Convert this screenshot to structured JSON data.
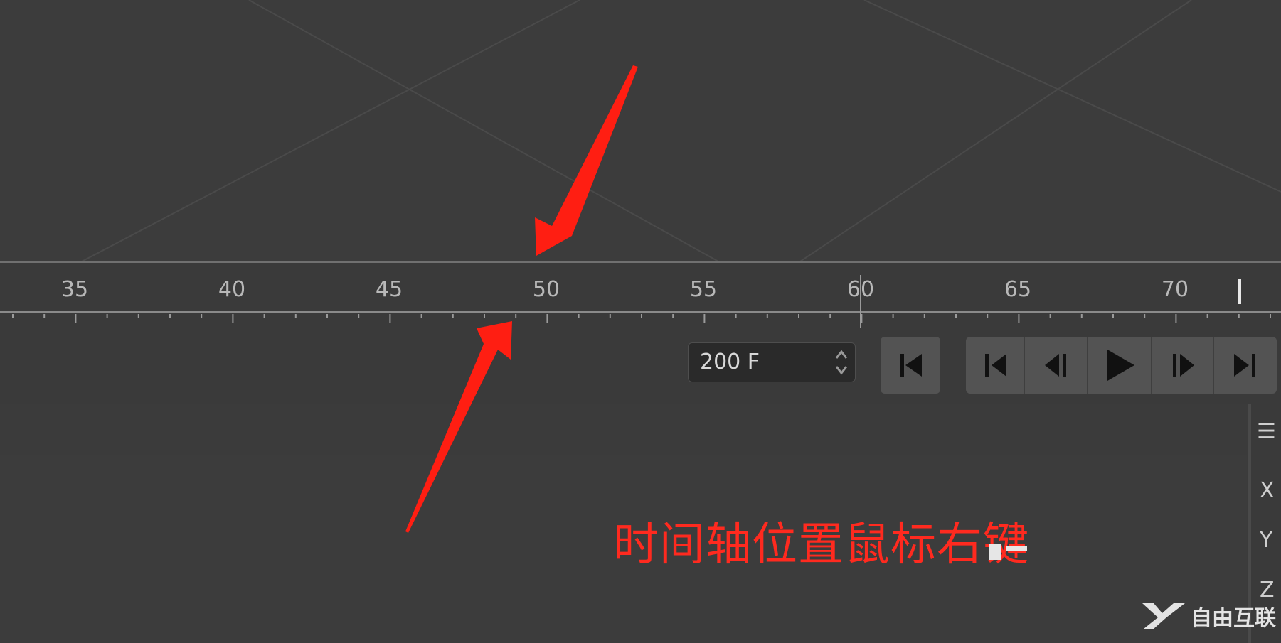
{
  "timeline": {
    "ticks": [
      {
        "label": "35"
      },
      {
        "label": "40"
      },
      {
        "label": "45"
      },
      {
        "label": "50"
      },
      {
        "label": "55"
      },
      {
        "label": "60"
      },
      {
        "label": "65"
      },
      {
        "label": "70"
      }
    ],
    "current_frame": 60
  },
  "controls": {
    "frame_field": "200 F",
    "buttons": [
      "go-to-start",
      "go-to-previous-key",
      "previous-frame",
      "play",
      "next-frame",
      "go-to-end"
    ]
  },
  "side_panel": {
    "menu_icon": "hamburger-icon",
    "axis_labels": [
      "X",
      "Y",
      "Z"
    ]
  },
  "annotation": {
    "text": "时间轴位置鼠标右键"
  },
  "watermark": {
    "text": "自由互联"
  },
  "colors": {
    "accent_arrow": "#ff2a1f",
    "background": "#3b3b3b"
  }
}
